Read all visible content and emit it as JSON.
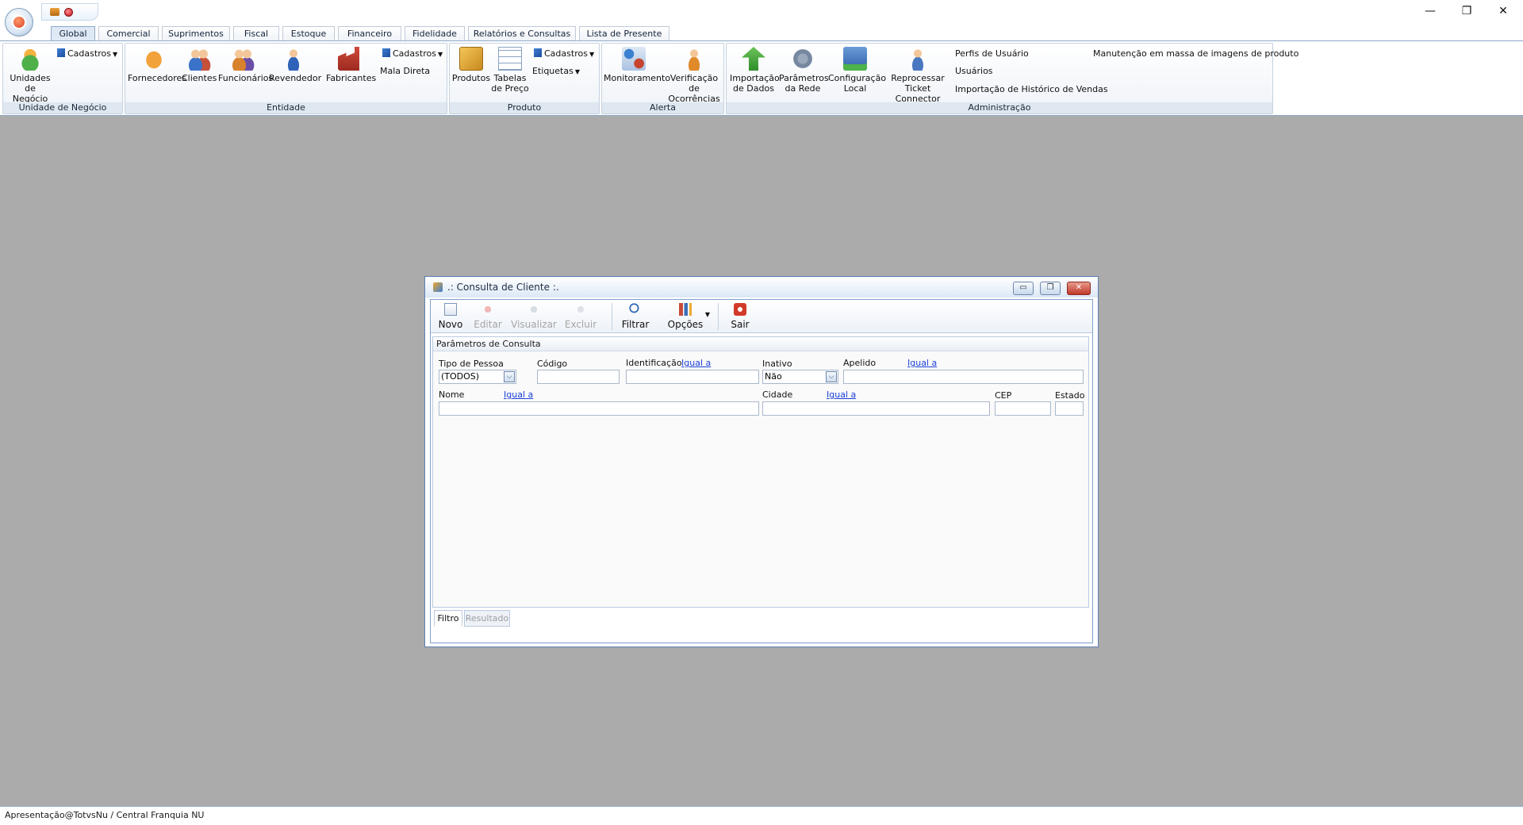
{
  "quick_access": {
    "icons": [
      "users-icon",
      "close-red-icon"
    ]
  },
  "window_controls": {
    "minimize": "—",
    "restore": "❐",
    "close": "✕"
  },
  "tabs": [
    {
      "label": "Global",
      "active": true
    },
    {
      "label": "Comercial"
    },
    {
      "label": "Suprimentos"
    },
    {
      "label": "Fiscal"
    },
    {
      "label": "Estoque"
    },
    {
      "label": "Financeiro"
    },
    {
      "label": "Fidelidade"
    },
    {
      "label": "Relatórios e Consultas"
    },
    {
      "label": "Lista de Presente"
    }
  ],
  "ribbon": {
    "unidade": {
      "label": "Unidade de Negócio",
      "unidades_line1": "Unidades",
      "unidades_line2": "de Negócio",
      "cadastros": "Cadastros"
    },
    "entidade": {
      "label": "Entidade",
      "fornecedores": "Fornecedores",
      "clientes": "Clientes",
      "funcionarios": "Funcionários",
      "revendedor": "Revendedor",
      "fabricantes": "Fabricantes",
      "cadastros": "Cadastros",
      "mala_direta": "Mala Direta"
    },
    "produto": {
      "label": "Produto",
      "produtos": "Produtos",
      "tabelas_line1": "Tabelas",
      "tabelas_line2": "de Preço",
      "cadastros": "Cadastros",
      "etiquetas": "Etiquetas"
    },
    "alerta": {
      "label": "Alerta",
      "monitoramento": "Monitoramento",
      "verificacao_line1": "Verificação de",
      "verificacao_line2": "Ocorrências"
    },
    "administracao": {
      "label": "Administração",
      "importacao_line1": "Importação",
      "importacao_line2": "de Dados",
      "parametros_line1": "Parâmetros",
      "parametros_line2": "da Rede",
      "configuracao_line1": "Configuração",
      "configuracao_line2": "Local",
      "reprocessar_line1": "Reprocessar",
      "reprocessar_line2": "Ticket Connector",
      "perfis": "Perfis de Usuário",
      "usuarios": "Usuários",
      "importacao_historico": "Importação de Histórico de Vendas",
      "manutencao_imagens": "Manutenção em massa de imagens de produto"
    }
  },
  "child_window": {
    "title": ".: Consulta de Cliente :.",
    "buttons": {
      "minimize": "▭",
      "restore": "❐",
      "close": "✕"
    },
    "toolbar": {
      "novo": "Novo",
      "editar": "Editar",
      "visualizar": "Visualizar",
      "excluir": "Excluir",
      "filtrar": "Filtrar",
      "opcoes": "Opções",
      "sair": "Sair"
    },
    "params": {
      "header": "Parâmetros de Consulta",
      "tipo_pessoa_label": "Tipo de Pessoa",
      "tipo_pessoa_value": "(TODOS)",
      "codigo_label": "Código",
      "codigo_value": "",
      "identificacao_label": "Identificação",
      "identificacao_link": "Igual a",
      "identificacao_value": "",
      "inativo_label": "Inativo",
      "inativo_value": "Não",
      "apelido_label": "Apelido",
      "apelido_link": "Igual a",
      "apelido_value": "",
      "nome_label": "Nome",
      "nome_link": "Igual a",
      "nome_value": "",
      "cidade_label": "Cidade",
      "cidade_link": "Igual a",
      "cidade_value": "",
      "cep_label": "CEP",
      "cep_value": "",
      "estado_label": "Estado",
      "estado_value": ""
    },
    "bottom_tabs": {
      "filtro": "Filtro",
      "resultado": "Resultado"
    }
  },
  "status_bar": {
    "text": "Apresentação@TotvsNu / Central Franquia NU"
  }
}
